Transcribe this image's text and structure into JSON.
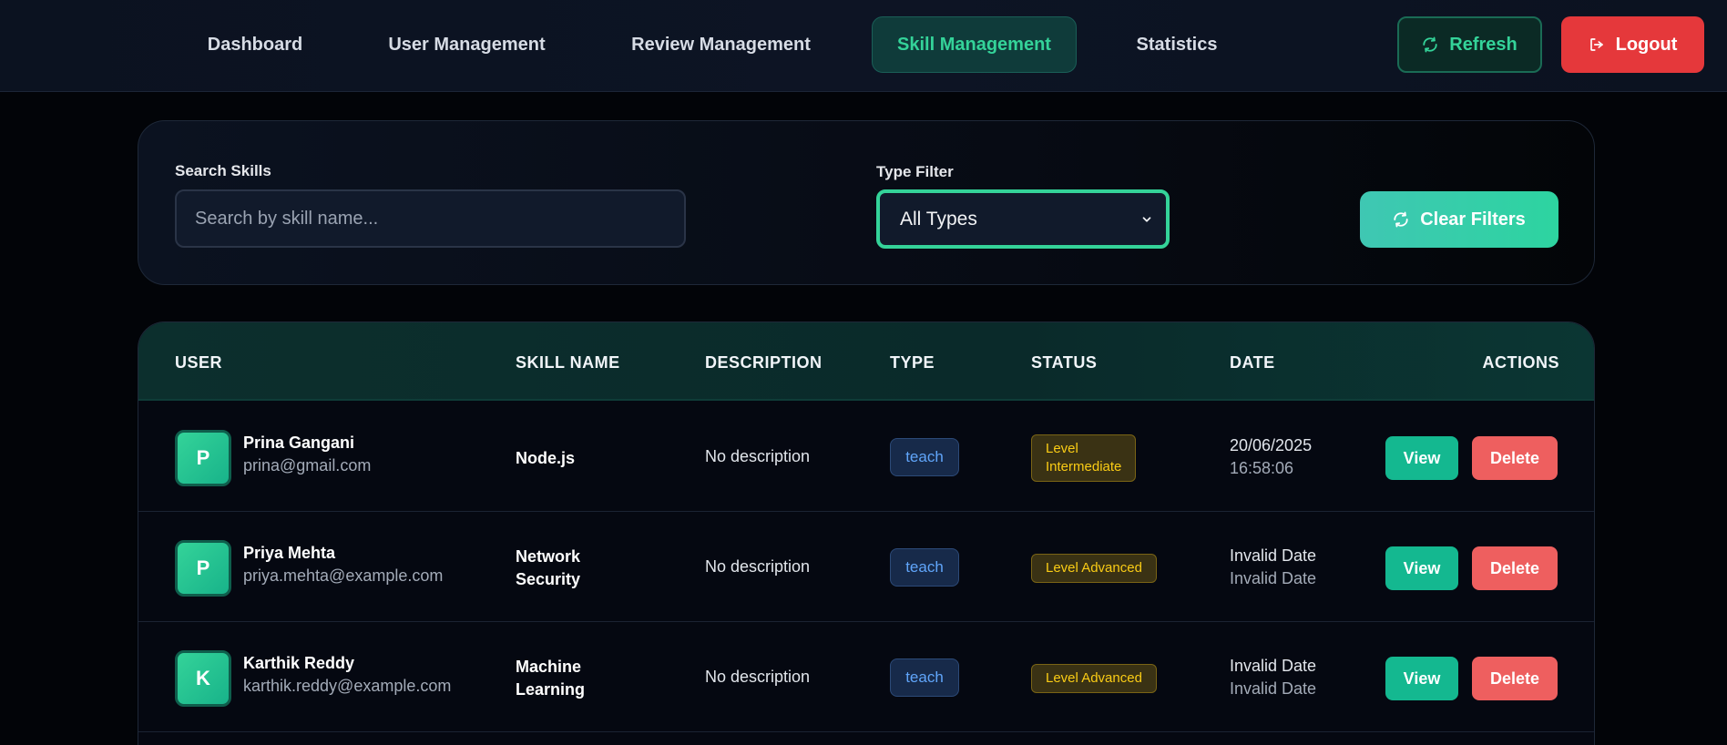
{
  "nav": {
    "items": [
      {
        "label": "Dashboard"
      },
      {
        "label": "User Management"
      },
      {
        "label": "Review Management"
      },
      {
        "label": "Skill Management",
        "active": true
      },
      {
        "label": "Statistics"
      }
    ],
    "refresh_label": "Refresh",
    "logout_label": "Logout"
  },
  "filters": {
    "search_label": "Search Skills",
    "search_placeholder": "Search by skill name...",
    "search_value": "",
    "type_label": "Type Filter",
    "type_value": "All Types",
    "clear_label": "Clear Filters"
  },
  "table": {
    "headers": [
      "USER",
      "SKILL NAME",
      "DESCRIPTION",
      "TYPE",
      "STATUS",
      "DATE",
      "ACTIONS"
    ],
    "rows": [
      {
        "initial": "P",
        "name": "Prina Gangani",
        "email": "prina@gmail.com",
        "skill_line1": "Node.js",
        "skill_line2": "",
        "description": "No description",
        "type": "teach",
        "status_line1": "Level",
        "status_line2": "Intermediate",
        "date": "20/06/2025",
        "time": "16:58:06",
        "view_label": "View",
        "delete_label": "Delete"
      },
      {
        "initial": "P",
        "name": "Priya Mehta",
        "email": "priya.mehta@example.com",
        "skill_line1": "Network",
        "skill_line2": "Security",
        "description": "No description",
        "type": "teach",
        "status_line1": "Level Advanced",
        "status_line2": "",
        "date": "Invalid Date",
        "time": "Invalid Date",
        "view_label": "View",
        "delete_label": "Delete"
      },
      {
        "initial": "K",
        "name": "Karthik Reddy",
        "email": "karthik.reddy@example.com",
        "skill_line1": "Machine",
        "skill_line2": "Learning",
        "description": "No description",
        "type": "teach",
        "status_line1": "Level Advanced",
        "status_line2": "",
        "date": "Invalid Date",
        "time": "Invalid Date",
        "view_label": "View",
        "delete_label": "Delete"
      }
    ]
  },
  "colors": {
    "accent": "#34d399",
    "danger": "#e5383b",
    "background": "#020408"
  },
  "icons": {
    "refresh": "refresh-icon",
    "logout": "logout-icon",
    "chevron": "chevron-down-icon"
  }
}
